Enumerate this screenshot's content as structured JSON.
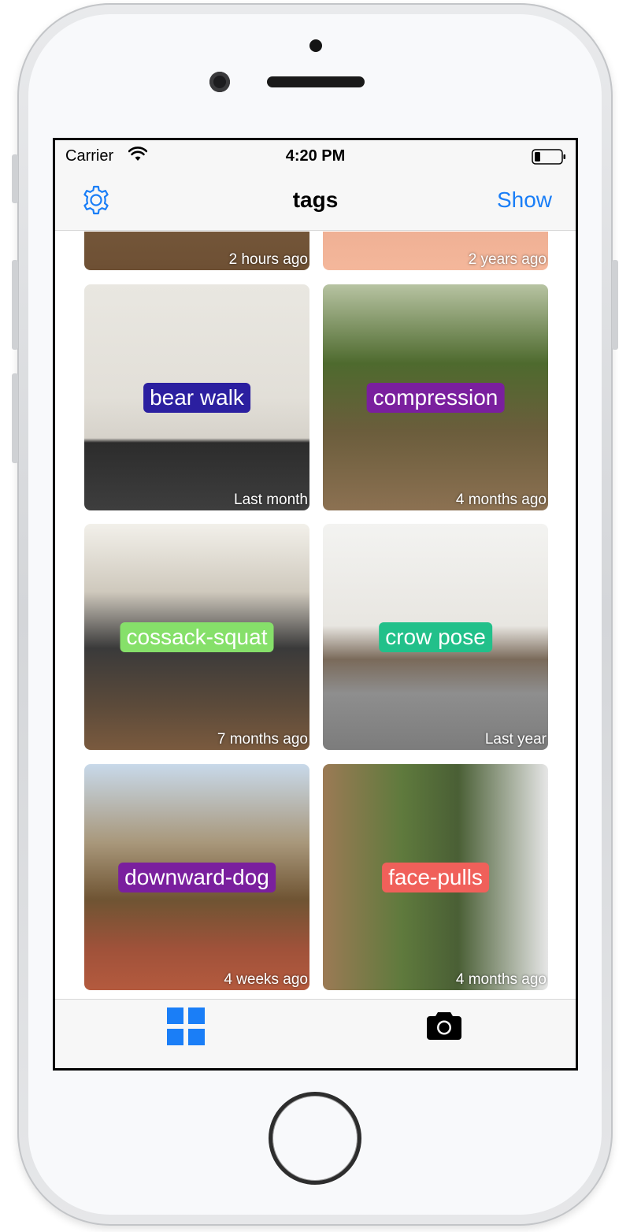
{
  "status_bar": {
    "carrier": "Carrier",
    "time": "4:20 PM"
  },
  "nav": {
    "title": "tags",
    "show_label": "Show",
    "settings_icon": "gear-icon"
  },
  "grid": {
    "cells": [
      {
        "tag": "",
        "age": "2 hours ago"
      },
      {
        "tag": "",
        "age": "2 years ago"
      },
      {
        "tag": "bear walk",
        "age": "Last month",
        "tag_color": "#2b1fa0"
      },
      {
        "tag": "compression",
        "age": "4 months ago",
        "tag_color": "#7a1f9e"
      },
      {
        "tag": "cossack-squat",
        "age": "7 months ago",
        "tag_color": "#86e06a"
      },
      {
        "tag": "crow pose",
        "age": "Last year",
        "tag_color": "#22c08a"
      },
      {
        "tag": "downward-dog",
        "age": "4 weeks ago",
        "tag_color": "#7a1f9e"
      },
      {
        "tag": "face-pulls",
        "age": "4 months ago",
        "tag_color": "#f0605a"
      }
    ]
  },
  "tab_bar": {
    "tabs": [
      {
        "icon": "grid-icon",
        "selected": true
      },
      {
        "icon": "camera-icon",
        "selected": false
      }
    ],
    "accent": "#1a7ef7"
  }
}
